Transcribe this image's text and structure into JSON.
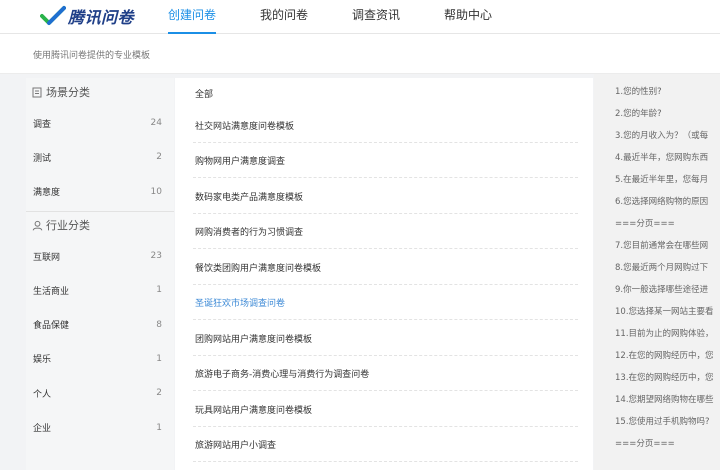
{
  "header": {
    "logo_text": "腾讯问卷",
    "nav": [
      {
        "label": "创建问卷",
        "active": true
      },
      {
        "label": "我的问卷",
        "active": false
      },
      {
        "label": "调查资讯",
        "active": false
      },
      {
        "label": "帮助中心",
        "active": false
      }
    ]
  },
  "subtitle": "使用腾讯问卷提供的专业模板",
  "sidebar": {
    "scene_title": "场景分类",
    "scene_items": [
      {
        "label": "调查",
        "count": "24"
      },
      {
        "label": "测试",
        "count": "2"
      },
      {
        "label": "满意度",
        "count": "10"
      }
    ],
    "industry_title": "行业分类",
    "industry_items": [
      {
        "label": "互联网",
        "count": "23"
      },
      {
        "label": "生活商业",
        "count": "1"
      },
      {
        "label": "食品保健",
        "count": "8"
      },
      {
        "label": "娱乐",
        "count": "1"
      },
      {
        "label": "个人",
        "count": "2"
      },
      {
        "label": "企业",
        "count": "1"
      }
    ]
  },
  "templates": {
    "all_label": "全部",
    "items": [
      {
        "label": "社交网站满意度问卷模板"
      },
      {
        "label": "购物网用户满意度调查"
      },
      {
        "label": "数码家电类产品满意度模板"
      },
      {
        "label": "网购消费者的行为习惯调查"
      },
      {
        "label": "餐饮类团购用户满意度问卷模板"
      },
      {
        "label": "圣诞狂欢市场调查问卷"
      },
      {
        "label": "团购网站用户满意度问卷模板"
      },
      {
        "label": "旅游电子商务-消费心理与消费行为调查问卷"
      },
      {
        "label": "玩具网站用户满意度问卷模板"
      },
      {
        "label": "旅游网站用户小调查"
      }
    ]
  },
  "preview": {
    "questions": [
      "1.您的性别?",
      "2.您的年龄?",
      "3.您的月收入为？（或每",
      "4.最近半年，您网购东西",
      "5.在最近半年里，您每月",
      "6.您选择网络购物的原因",
      "===分页===",
      "7.您目前通常会在哪些网",
      "8.您最近两个月网购过下",
      "9.你一般选择哪些途径进",
      "10.您选择某一网站主要看",
      "11.目前为止的网购体验，",
      "12.在您的网购经历中，您",
      "13.在您的网购经历中，您",
      "14.您期望网络购物在哪些",
      "15.您使用过手机购物吗?",
      "===分页==="
    ]
  },
  "colors": {
    "accent": "#1b8fe6",
    "link": "#3d8ad6"
  }
}
